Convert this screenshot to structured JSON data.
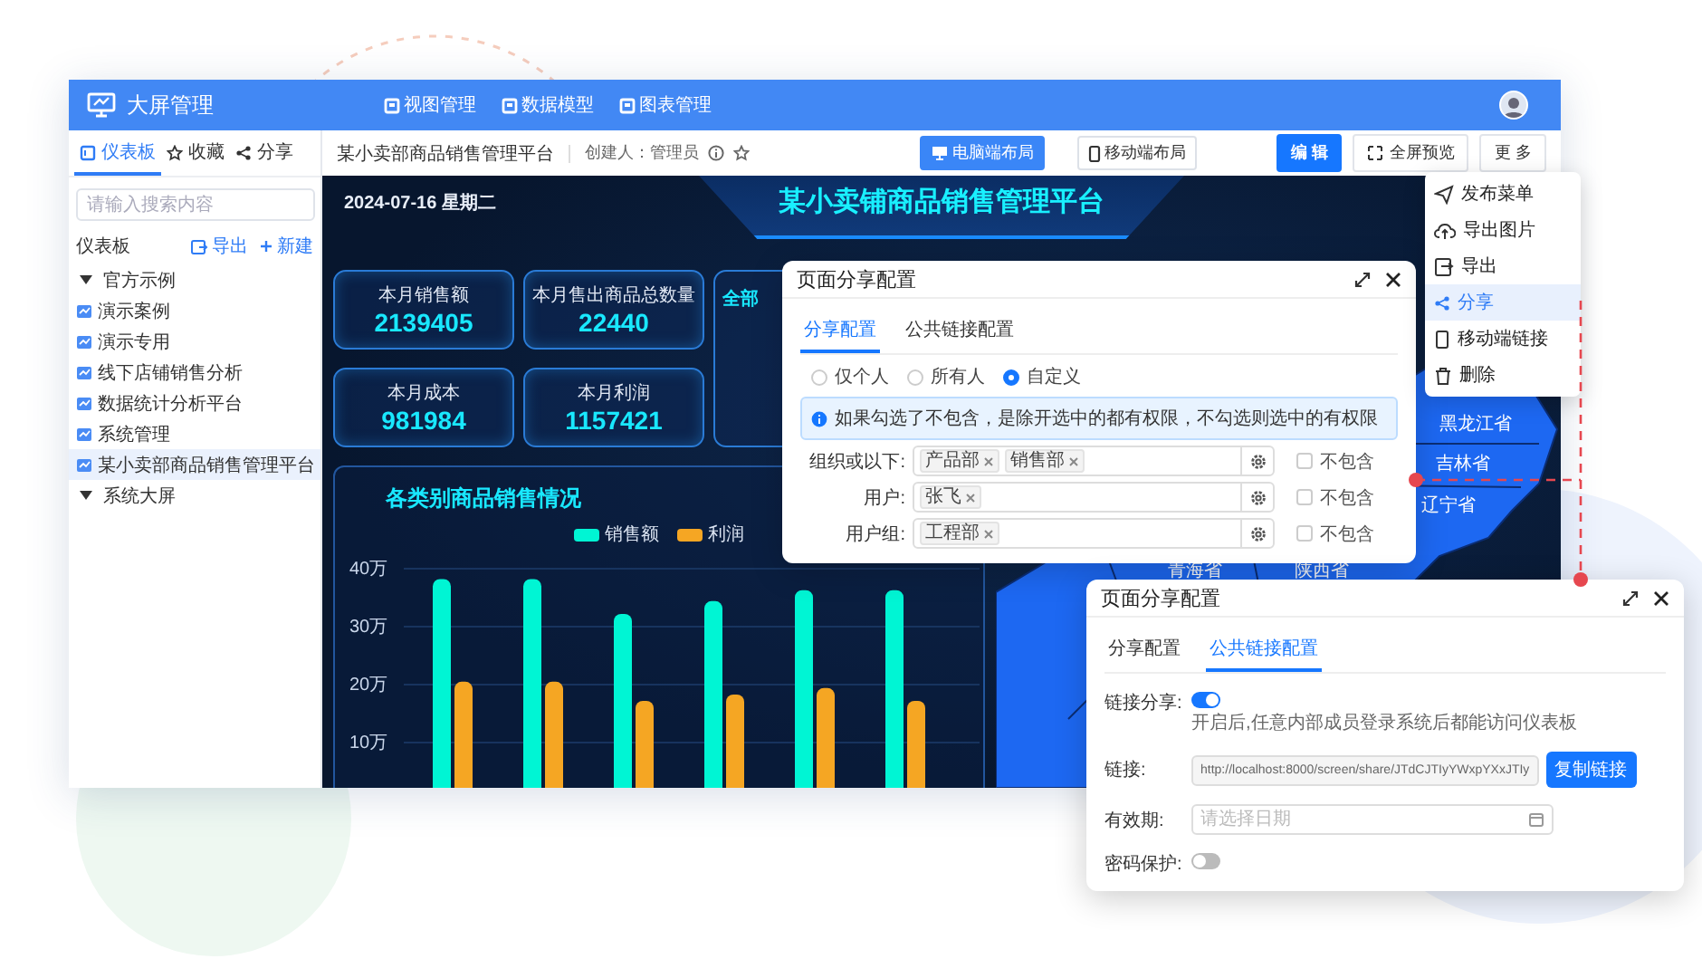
{
  "app": {
    "title": "大屏管理",
    "nav": [
      {
        "label": "视图管理"
      },
      {
        "label": "数据模型"
      },
      {
        "label": "图表管理"
      }
    ]
  },
  "sidebar": {
    "tabs": [
      {
        "label": "仪表板",
        "selected": true
      },
      {
        "label": "收藏",
        "selected": false
      },
      {
        "label": "分享",
        "selected": false
      }
    ],
    "search": {
      "placeholder": "请输入搜索内容"
    },
    "section": {
      "title": "仪表板",
      "actions": [
        {
          "label": "导出",
          "kind": "export"
        },
        {
          "label": "新建",
          "kind": "new"
        }
      ]
    },
    "tree": [
      {
        "label": "官方示例",
        "expanded": true,
        "selected": false,
        "children": [
          {
            "label": "演示案例",
            "selected": false
          },
          {
            "label": "演示专用",
            "selected": false
          },
          {
            "label": "线下店铺销售分析",
            "selected": false
          },
          {
            "label": "数据统计分析平台",
            "selected": false
          },
          {
            "label": "系统管理",
            "selected": false
          },
          {
            "label": "某小卖部商品销售管理平台",
            "selected": true
          }
        ]
      },
      {
        "label": "系统大屏",
        "expanded": true,
        "selected": false
      }
    ]
  },
  "toolbar": {
    "title": "某小卖部商品销售管理平台",
    "creator": "创建人：管理员",
    "layouts": [
      {
        "label": "电脑端布局",
        "kind": "desktop",
        "selected": true
      },
      {
        "label": "移动端布局",
        "kind": "mobile",
        "selected": false
      }
    ],
    "buttons": [
      {
        "label": "编 辑",
        "kind": "primary"
      },
      {
        "label": "全屏预览",
        "kind": "fullscreen"
      },
      {
        "label": "更 多",
        "kind": "default"
      }
    ]
  },
  "dashboard": {
    "date": "2024-07-16 星期二",
    "title": "某小卖铺商品销售管理平台",
    "kpis": [
      {
        "label": "本月销售额",
        "value": "2139405"
      },
      {
        "label": "本月售出商品总数量",
        "value": "22440"
      },
      {
        "label": "本月成本",
        "value": "981984"
      },
      {
        "label": "本月利润",
        "value": "1157421"
      }
    ],
    "side_panel": {
      "title": "全部"
    },
    "chart": {
      "title": "各类别商品销售情况",
      "chart_data": {
        "type": "bar",
        "grid": true,
        "ylim": [
          0,
          40
        ],
        "yticks": [
          {
            "value": 10,
            "label": "10万"
          },
          {
            "value": 20,
            "label": "20万"
          },
          {
            "value": 30,
            "label": "30万"
          },
          {
            "value": 40,
            "label": "40万"
          }
        ],
        "series": [
          {
            "name": "销售额",
            "color": "#00f5d4",
            "values": [
              38.2,
              38.2,
              32.2,
              34.4,
              36.3,
              36.3
            ]
          },
          {
            "name": "利润",
            "color": "#f5a623",
            "values": [
              20.5,
              20.5,
              17.2,
              18.3,
              19.4,
              17.2
            ]
          }
        ]
      }
    },
    "map": {
      "labels": [
        "黑龙江省",
        "吉林省",
        "辽宁省",
        "青海省",
        "陕西省"
      ]
    }
  },
  "menu": {
    "items": [
      {
        "label": "发布菜单",
        "kind": "publish",
        "selected": false
      },
      {
        "label": "导出图片",
        "kind": "export-image",
        "selected": false
      },
      {
        "label": "导出",
        "kind": "export",
        "selected": false
      },
      {
        "label": "分享",
        "kind": "share",
        "selected": true
      },
      {
        "label": "移动端链接",
        "kind": "mobile",
        "selected": false
      },
      {
        "label": "删除",
        "kind": "delete",
        "selected": false
      }
    ]
  },
  "dialogs": [
    {
      "kind": "permissions",
      "title": "页面分享配置",
      "tabs": [
        {
          "label": "分享配置",
          "selected": true
        },
        {
          "label": "公共链接配置",
          "selected": false
        }
      ],
      "scopes": [
        {
          "label": "仅个人",
          "selected": false
        },
        {
          "label": "所有人",
          "selected": false
        },
        {
          "label": "自定义",
          "selected": true
        }
      ],
      "notice": "如果勾选了不包含，是除开选中的都有权限，不勾选则选中的有权限",
      "rules": [
        {
          "label": "组织或以下:",
          "tags": [
            "产品部",
            "销售部"
          ],
          "exclude": {
            "label": "不包含",
            "checked": false
          }
        },
        {
          "label": "用户:",
          "tags": [
            "张飞"
          ],
          "exclude": {
            "label": "不包含",
            "checked": false
          }
        },
        {
          "label": "用户组:",
          "tags": [
            "工程部"
          ],
          "exclude": {
            "label": "不包含",
            "checked": false
          }
        }
      ]
    },
    {
      "kind": "public_link",
      "title": "页面分享配置",
      "tabs": [
        {
          "label": "分享配置",
          "selected": false
        },
        {
          "label": "公共链接配置",
          "selected": true
        }
      ],
      "fields": [
        {
          "kind": "toggle",
          "label": "链接分享:",
          "on": true,
          "hint": "开启后,任意内部成员登录系统后都能访问仪表板"
        },
        {
          "kind": "link",
          "label": "链接:",
          "value": "http://localhost:8000/screen/share/JTdCJTIyYWxpYXxJTIy",
          "button": "复制链接"
        },
        {
          "kind": "date",
          "label": "有效期:",
          "placeholder": "请选择日期"
        },
        {
          "kind": "toggle",
          "label": "密码保护:",
          "on": false
        }
      ]
    }
  ]
}
